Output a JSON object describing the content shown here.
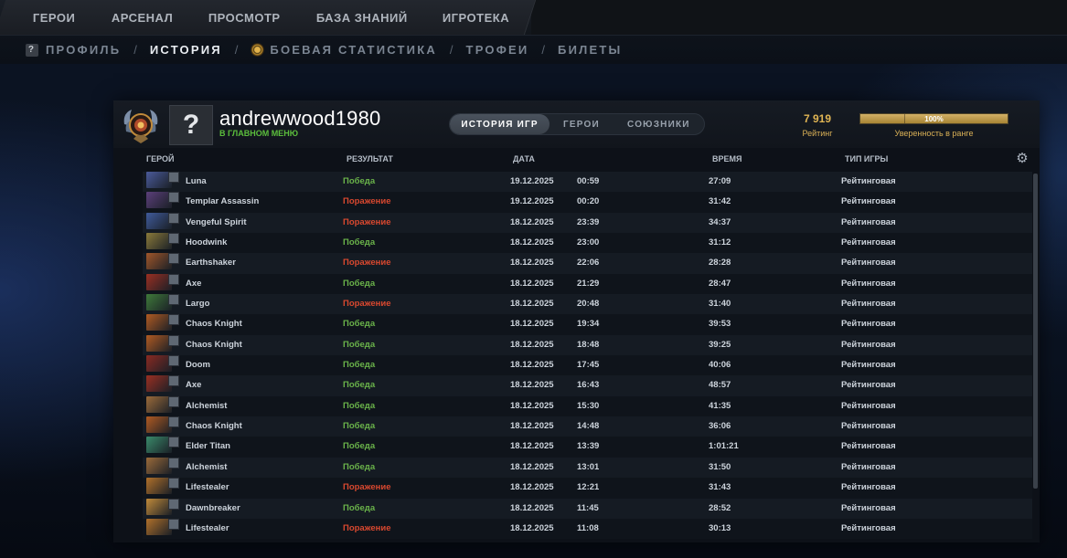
{
  "topnav": {
    "tabs": [
      {
        "label": "ГЕРОИ"
      },
      {
        "label": "АРСЕНАЛ"
      },
      {
        "label": "ПРОСМОТР"
      },
      {
        "label": "БАЗА ЗНАНИЙ"
      },
      {
        "label": "ИГРОТЕКА"
      }
    ]
  },
  "subnav": {
    "profile": "ПРОФИЛЬ",
    "history": "ИСТОРИЯ",
    "battle_stats": "БОЕВАЯ СТАТИСТИКА",
    "trophies": "ТРОФЕИ",
    "tickets": "БИЛЕТЫ",
    "separator": "/",
    "profile_icon_glyph": "?"
  },
  "profile": {
    "avatar_glyph": "?",
    "username": "andrewwood1980",
    "status": "В ГЛАВНОМ МЕНЮ",
    "mmr": "7 919",
    "mmr_label": "Рейтинг",
    "confidence_value": "100%",
    "confidence_fraction": 1.0,
    "confidence_label": "Уверенность в ранге"
  },
  "segment": {
    "history": "ИСТОРИЯ ИГР",
    "heroes": "ГЕРОИ",
    "allies": "СОЮЗНИКИ"
  },
  "columns": {
    "hero": "ГЕРОЙ",
    "result": "РЕЗУЛЬТАТ",
    "date": "ДАТА",
    "duration": "ВРЕМЯ",
    "game_type": "ТИП ИГРЫ"
  },
  "colors": {
    "win": "#6ab34a",
    "loss": "#d9482f",
    "gold": "#e0b553"
  },
  "matches": [
    {
      "hero": "Luna",
      "result": "Победа",
      "win": true,
      "date": "19.12.2025",
      "time": "00:59",
      "duration": "27:09",
      "type": "Рейтинговая",
      "color": "#4a5a9a"
    },
    {
      "hero": "Templar Assassin",
      "result": "Поражение",
      "win": false,
      "date": "19.12.2025",
      "time": "00:20",
      "duration": "31:42",
      "type": "Рейтинговая",
      "color": "#5b3f7a"
    },
    {
      "hero": "Vengeful Spirit",
      "result": "Поражение",
      "win": false,
      "date": "18.12.2025",
      "time": "23:39",
      "duration": "34:37",
      "type": "Рейтинговая",
      "color": "#3f5a9a"
    },
    {
      "hero": "Hoodwink",
      "result": "Победа",
      "win": true,
      "date": "18.12.2025",
      "time": "23:00",
      "duration": "31:12",
      "type": "Рейтинговая",
      "color": "#8a7a3a"
    },
    {
      "hero": "Earthshaker",
      "result": "Поражение",
      "win": false,
      "date": "18.12.2025",
      "time": "22:06",
      "duration": "28:28",
      "type": "Рейтинговая",
      "color": "#a0562a"
    },
    {
      "hero": "Axe",
      "result": "Победа",
      "win": true,
      "date": "18.12.2025",
      "time": "21:29",
      "duration": "28:47",
      "type": "Рейтинговая",
      "color": "#9a2f22"
    },
    {
      "hero": "Largo",
      "result": "Поражение",
      "win": false,
      "date": "18.12.2025",
      "time": "20:48",
      "duration": "31:40",
      "type": "Рейтинговая",
      "color": "#3f7a3a"
    },
    {
      "hero": "Chaos Knight",
      "result": "Победа",
      "win": true,
      "date": "18.12.2025",
      "time": "19:34",
      "duration": "39:53",
      "type": "Рейтинговая",
      "color": "#b05a22"
    },
    {
      "hero": "Chaos Knight",
      "result": "Победа",
      "win": true,
      "date": "18.12.2025",
      "time": "18:48",
      "duration": "39:25",
      "type": "Рейтинговая",
      "color": "#b05a22"
    },
    {
      "hero": "Doom",
      "result": "Победа",
      "win": true,
      "date": "18.12.2025",
      "time": "17:45",
      "duration": "40:06",
      "type": "Рейтинговая",
      "color": "#8a2a22"
    },
    {
      "hero": "Axe",
      "result": "Победа",
      "win": true,
      "date": "18.12.2025",
      "time": "16:43",
      "duration": "48:57",
      "type": "Рейтинговая",
      "color": "#9a2f22"
    },
    {
      "hero": "Alchemist",
      "result": "Победа",
      "win": true,
      "date": "18.12.2025",
      "time": "15:30",
      "duration": "41:35",
      "type": "Рейтинговая",
      "color": "#9a6a3a"
    },
    {
      "hero": "Chaos Knight",
      "result": "Победа",
      "win": true,
      "date": "18.12.2025",
      "time": "14:48",
      "duration": "36:06",
      "type": "Рейтинговая",
      "color": "#b05a22"
    },
    {
      "hero": "Elder Titan",
      "result": "Победа",
      "win": true,
      "date": "18.12.2025",
      "time": "13:39",
      "duration": "1:01:21",
      "type": "Рейтинговая",
      "color": "#3a8a6a"
    },
    {
      "hero": "Alchemist",
      "result": "Победа",
      "win": true,
      "date": "18.12.2025",
      "time": "13:01",
      "duration": "31:50",
      "type": "Рейтинговая",
      "color": "#9a6a3a"
    },
    {
      "hero": "Lifestealer",
      "result": "Поражение",
      "win": false,
      "date": "18.12.2025",
      "time": "12:21",
      "duration": "31:43",
      "type": "Рейтинговая",
      "color": "#b0702a"
    },
    {
      "hero": "Dawnbreaker",
      "result": "Победа",
      "win": true,
      "date": "18.12.2025",
      "time": "11:45",
      "duration": "28:52",
      "type": "Рейтинговая",
      "color": "#c08a3a"
    },
    {
      "hero": "Lifestealer",
      "result": "Поражение",
      "win": false,
      "date": "18.12.2025",
      "time": "11:08",
      "duration": "30:13",
      "type": "Рейтинговая",
      "color": "#b0702a"
    }
  ]
}
